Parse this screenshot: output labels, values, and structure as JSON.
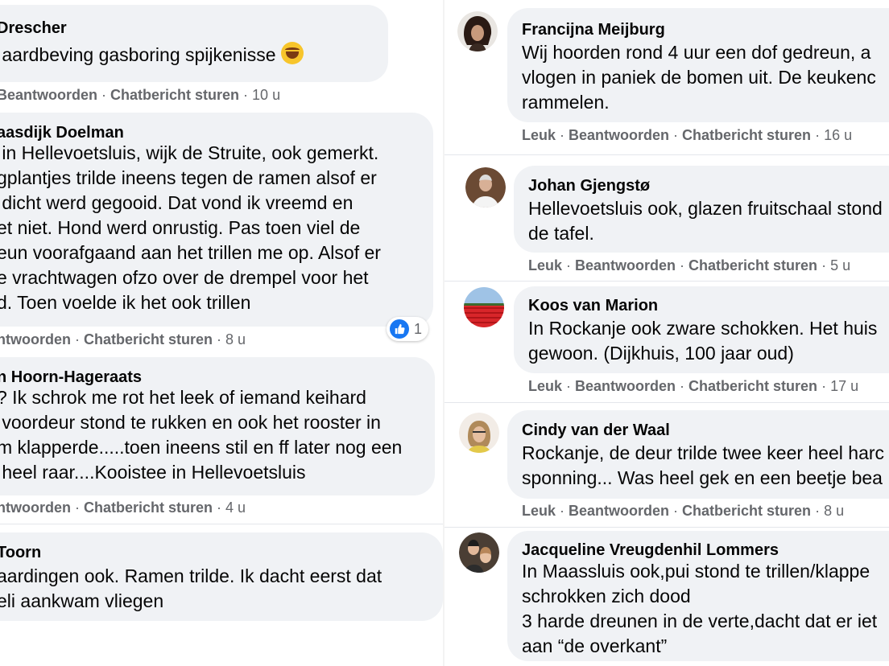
{
  "left": {
    "comments": [
      {
        "name": "Drescher",
        "lines": [
          " aardbeving gasboring spijkenisse"
        ],
        "emoji": "rolling-on-floor-laughing",
        "reply": "Beantwoorden",
        "chat": "Chatbericht sturen",
        "time": "10 u"
      },
      {
        "name": "aasdijk Doelman",
        "lines": [
          " in Hellevoetsluis, wijk de Struite, ook gemerkt.",
          "gplantjes trilde ineens tegen de ramen alsof er",
          " dicht werd gegooid. Dat vond ik vreemd en",
          "et niet. Hond werd onrustig. Pas toen viel de",
          "eun voorafgaand aan het trillen me op. Alsof er",
          "e vrachtwagen ofzo over de drempel voor het",
          "d. Toen voelde ik het ook trillen"
        ],
        "reply": "ntwoorden",
        "chat": "Chatbericht sturen",
        "time": "8 u",
        "reaction_count": "1"
      },
      {
        "name": "n Hoorn-Hageraats",
        "lines": [
          "? Ik schrok me rot het leek of iemand keihard",
          " voordeur stond te rukken en ook het rooster in",
          "m klapperde.....toen ineens stil en ff later nog een",
          " heel raar....Kooistee in Hellevoetsluis"
        ],
        "reply": "ntwoorden",
        "chat": "Chatbericht sturen",
        "time": "4 u"
      },
      {
        "name": " Toorn",
        "lines": [
          "aardingen ook. Ramen trilde. Ik dacht eerst dat",
          "eli aankwam vliegen"
        ]
      }
    ]
  },
  "right": {
    "comments": [
      {
        "name": "Francijna Meijburg",
        "lines": [
          "Wij hoorden rond 4 uur een dof gedreun, a",
          "vlogen in paniek de bomen uit. De keukenc",
          "rammelen."
        ],
        "like": "Leuk",
        "reply": "Beantwoorden",
        "chat": "Chatbericht sturen",
        "time": "16 u"
      },
      {
        "name": "Johan Gjengstø",
        "lines": [
          "Hellevoetsluis ook, glazen fruitschaal stond",
          "de tafel."
        ],
        "like": "Leuk",
        "reply": "Beantwoorden",
        "chat": "Chatbericht sturen",
        "time": "5 u"
      },
      {
        "name": "Koos van Marion",
        "lines": [
          "In Rockanje ook zware schokken. Het huis",
          "gewoon. (Dijkhuis, 100 jaar oud)"
        ],
        "like": "Leuk",
        "reply": "Beantwoorden",
        "chat": "Chatbericht sturen",
        "time": "17 u"
      },
      {
        "name": "Cindy van der Waal",
        "lines": [
          "Rockanje, de deur trilde twee keer heel harc",
          "sponning... Was heel gek en een beetje bea"
        ],
        "like": "Leuk",
        "reply": "Beantwoorden",
        "chat": "Chatbericht sturen",
        "time": "8 u"
      },
      {
        "name": "Jacqueline Vreugdenhil Lommers",
        "lines": [
          "In Maassluis ook,pui stond te trillen/klappe",
          "schrokken zich dood",
          "3 harde dreunen in de verte,dacht dat er iet",
          "aan “de overkant”"
        ]
      }
    ]
  },
  "colors": {
    "bubble": "#f0f2f5",
    "meta": "#65676b",
    "like_blue": "#1877f2"
  }
}
